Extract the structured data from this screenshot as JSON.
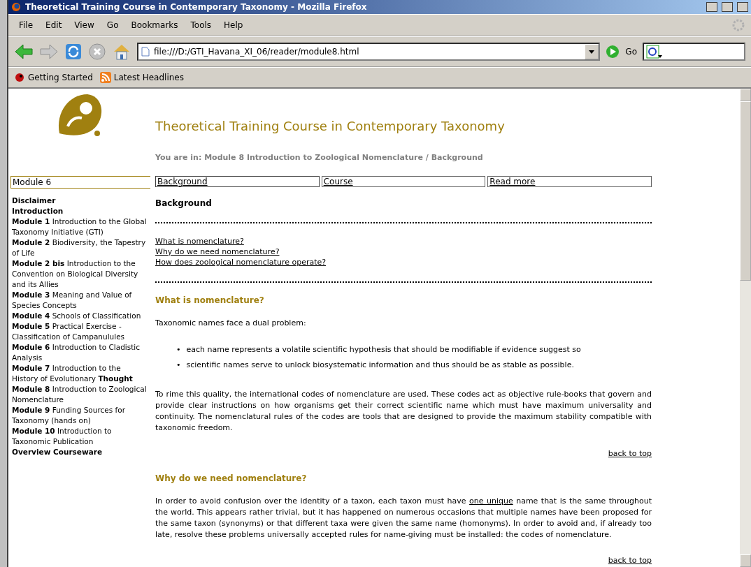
{
  "window": {
    "title": "Theoretical Training Course in Contemporary Taxonomy - Mozilla Firefox"
  },
  "menu": [
    "File",
    "Edit",
    "View",
    "Go",
    "Bookmarks",
    "Tools",
    "Help"
  ],
  "address": {
    "value": "file:///D:/GTI_Havana_XI_06/reader/module8.html"
  },
  "go_label": "Go",
  "bookmarks": [
    "Getting Started",
    "Latest Headlines"
  ],
  "page": {
    "heading": "Theoretical Training Course in Contemporary Taxonomy",
    "breadcrumb": "You are in: Module 8 Introduction to Zoological Nomenclature / Background",
    "module_select": {
      "value": "Module 6"
    },
    "sidebar": [
      {
        "text": "Disclaimer",
        "kind": "plain"
      },
      {
        "text": "Introduction",
        "kind": "plain"
      },
      {
        "text": "**Module 1** Introduction to the Global Taxonomy Initiative (GTI)",
        "kind": "module"
      },
      {
        "text": "**Module 2** Biodiversity, the Tapestry of Life",
        "kind": "module"
      },
      {
        "text": "**Module 2 bis** Introduction to the Convention on Biological Diversity and its Allies",
        "kind": "module"
      },
      {
        "text": "**Module 3** Meaning and Value of Species Concepts",
        "kind": "module"
      },
      {
        "text": "**Module 4** Schools of Classification",
        "kind": "module"
      },
      {
        "text": "**Module 5** Practical Exercise - Classification of Campanulules",
        "kind": "module"
      },
      {
        "text": "**Module 6** Introduction to Cladistic Analysis",
        "kind": "module"
      },
      {
        "text": "**Module 7** Introduction to the History of Evolutionary **Thought**",
        "kind": "module"
      },
      {
        "text": "**Module 8** Introduction to Zoological Nomenclature",
        "kind": "module"
      },
      {
        "text": "**Module 9** Funding Sources for Taxonomy (hands on)",
        "kind": "module"
      },
      {
        "text": "**Module 10** Introduction to Taxonomic Publication",
        "kind": "module"
      },
      {
        "text": "Overview Courseware",
        "kind": "plain"
      }
    ],
    "tabs": [
      {
        "label": "Background",
        "selected": true
      },
      {
        "label": "Course",
        "selected": false
      },
      {
        "label": "Read more",
        "selected": false
      }
    ],
    "section_title": "Background",
    "toc": [
      "What is nomenclature?",
      "Why do we need nomenclature?",
      "How does zoological nomenclature operate?"
    ],
    "sections": [
      {
        "title": "What is nomenclature?",
        "intro": "Taxonomic names face a dual problem:",
        "bullet_marker": "•",
        "bullets": [
          "each name represents a volatile scientific hypothesis that should be modifiable if evidence suggest so",
          "scientific names serve to unlock biosystematic information and thus should be as stable as possible."
        ],
        "before": "To rime this quality, the international codes of nomenclature are used. These codes act as objective rule-books that govern and provide clear instructions on how organisms get their correct scientific name which must have maximum universality and continuity. The nomenclatural rules of the codes are tools that are designed to provide the maximum stability compatible with taxonomic freedom.",
        "back": "back to top"
      },
      {
        "title": "Why do we need nomenclature?",
        "before": "In order to avoid confusion over the identity of a taxon, each taxon must have",
        "link": "one unique",
        "after": "name that is the same throughout the world. This appears rather trivial, but it has happened on numerous occasions that multiple names have been proposed for the same taxon (synonyms) or that different taxa were given the same name (homonyms). In order to avoid and, if already too late, resolve these problems universally accepted rules for name-giving must be installed: the codes of nomenclature.",
        "back": "back to top"
      }
    ]
  }
}
